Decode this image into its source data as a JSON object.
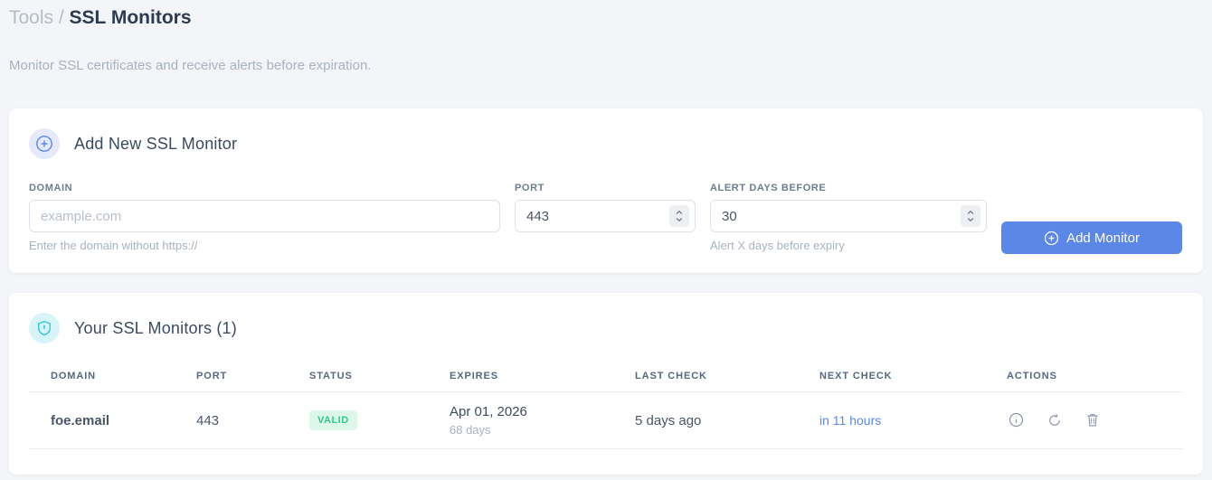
{
  "breadcrumb": {
    "section": "Tools /",
    "page": "SSL Monitors"
  },
  "subtitle": "Monitor SSL certificates and receive alerts before expiration.",
  "add_form": {
    "title": "Add New SSL Monitor",
    "header_icon": "plus-circle-icon",
    "fields": {
      "domain": {
        "label": "DOMAIN",
        "placeholder": "example.com",
        "value": "",
        "helper": "Enter the domain without https://"
      },
      "port": {
        "label": "PORT",
        "value": "443"
      },
      "alert_days": {
        "label": "ALERT DAYS BEFORE",
        "value": "30",
        "helper": "Alert X days before expiry"
      }
    },
    "submit_label": "Add Monitor",
    "submit_icon": "plus-circle-icon"
  },
  "monitors": {
    "title": "Your SSL Monitors (1)",
    "count": 1,
    "header_icon": "shield-icon",
    "columns": [
      "DOMAIN",
      "PORT",
      "STATUS",
      "EXPIRES",
      "LAST CHECK",
      "NEXT CHECK",
      "ACTIONS"
    ],
    "rows": [
      {
        "domain": "foe.email",
        "port": "443",
        "status": "VALID",
        "expires_date": "Apr 01, 2026",
        "expires_days": "68 days",
        "last_check": "5 days ago",
        "next_check": "in 11 hours",
        "actions": [
          "info-icon",
          "refresh-icon",
          "trash-icon"
        ]
      }
    ]
  },
  "colors": {
    "accent_blue": "#5b87e8",
    "accent_cyan": "#2ec9dd",
    "status_valid_bg": "#ddf8eb",
    "status_valid_text": "#2ecc8f",
    "page_bg": "#f3f5f8"
  }
}
